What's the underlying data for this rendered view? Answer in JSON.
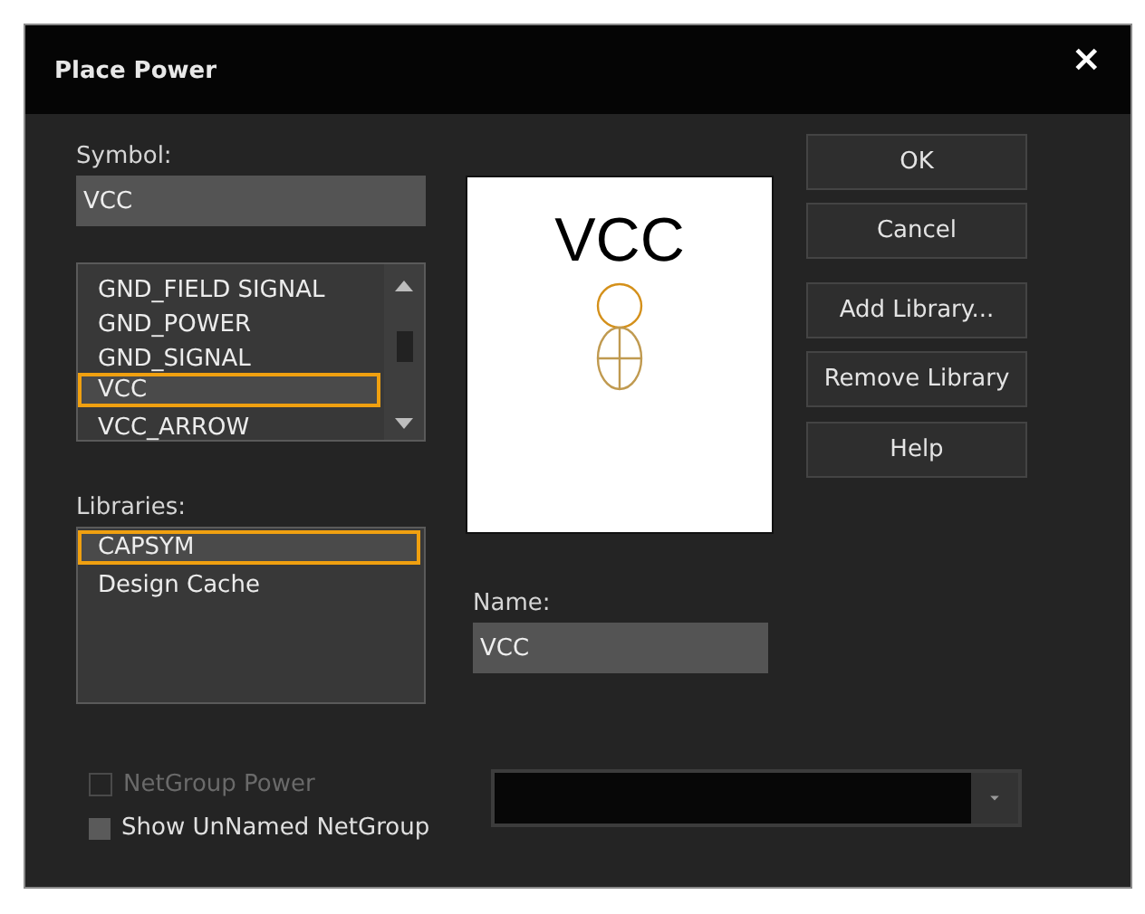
{
  "window": {
    "title": "Place Power",
    "close": "×"
  },
  "symbol": {
    "label": "Symbol:",
    "value": "VCC"
  },
  "symbol_list": {
    "items": [
      {
        "label": "GND_FIELD SIGNAL",
        "selected": false
      },
      {
        "label": "GND_POWER",
        "selected": false
      },
      {
        "label": "GND_SIGNAL",
        "selected": false
      },
      {
        "label": "VCC",
        "selected": true
      },
      {
        "label": "VCC_ARROW",
        "selected": false
      }
    ]
  },
  "libraries": {
    "label": "Libraries:",
    "items": [
      {
        "label": "CAPSYM",
        "selected": true
      },
      {
        "label": "Design Cache",
        "selected": false
      }
    ]
  },
  "preview": {
    "text": "VCC"
  },
  "name": {
    "label": "Name:",
    "value": "VCC"
  },
  "buttons": [
    "OK",
    "Cancel",
    "Add Library...",
    "Remove Library",
    "Help"
  ],
  "checkboxes": [
    {
      "label": "NetGroup Power",
      "checked": false,
      "disabled": true
    },
    {
      "label": "Show UnNamed NetGroup",
      "checked": false,
      "disabled": false
    }
  ],
  "netgroup_dropdown": {
    "disabled": false
  }
}
